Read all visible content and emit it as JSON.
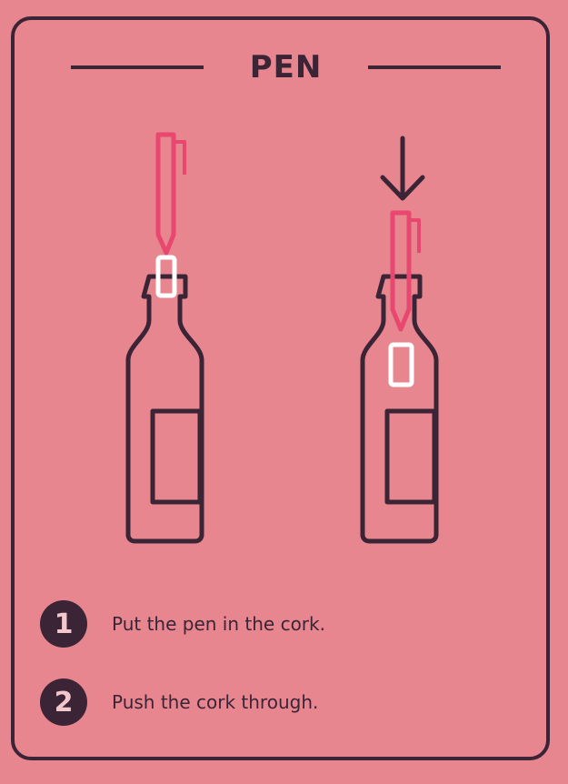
{
  "title": "PEN",
  "steps": [
    {
      "number": "1",
      "text": "Put the pen in the cork."
    },
    {
      "number": "2",
      "text": "Push the cork through."
    }
  ],
  "colors": {
    "background": "#e8868f",
    "ink": "#3a2436",
    "pen": "#e84870",
    "cork": "#ffffff"
  },
  "icons": [
    "wine-bottle-icon",
    "pen-icon",
    "cork-icon",
    "arrow-down-icon"
  ]
}
